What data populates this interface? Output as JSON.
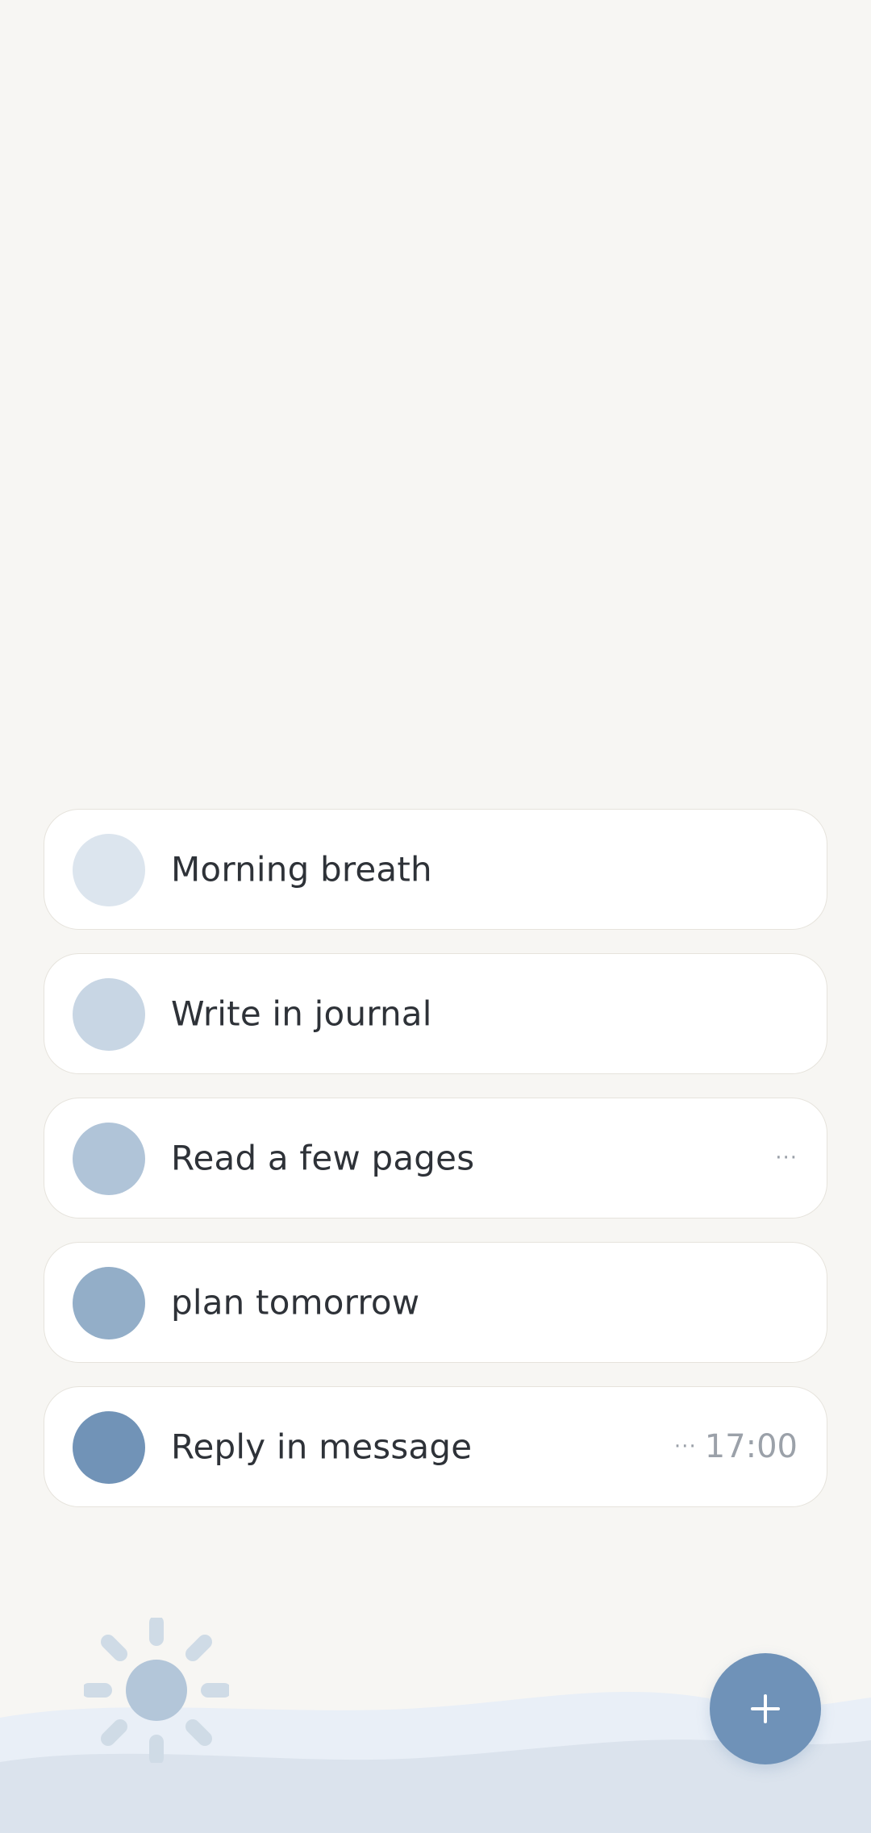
{
  "tasks": [
    {
      "label": "Morning breath",
      "dot_color": "#dce5ee",
      "has_more": false,
      "time": null
    },
    {
      "label": "Write in journal",
      "dot_color": "#c8d6e4",
      "has_more": false,
      "time": null
    },
    {
      "label": "Read a few pages",
      "dot_color": "#b0c4d8",
      "has_more": true,
      "time": null
    },
    {
      "label": "plan tomorrow",
      "dot_color": "#93aec8",
      "has_more": false,
      "time": null
    },
    {
      "label": "Reply in message",
      "dot_color": "#7193b7",
      "has_more": true,
      "time": "17:00"
    }
  ],
  "icons": {
    "more": "more-dots-icon",
    "sun": "sun-icon",
    "add": "plus-icon"
  },
  "colors": {
    "background": "#f7f6f3",
    "accent": "#6f92b8",
    "wave_light": "#e9eff7",
    "wave_dark": "#dbe3ed"
  }
}
